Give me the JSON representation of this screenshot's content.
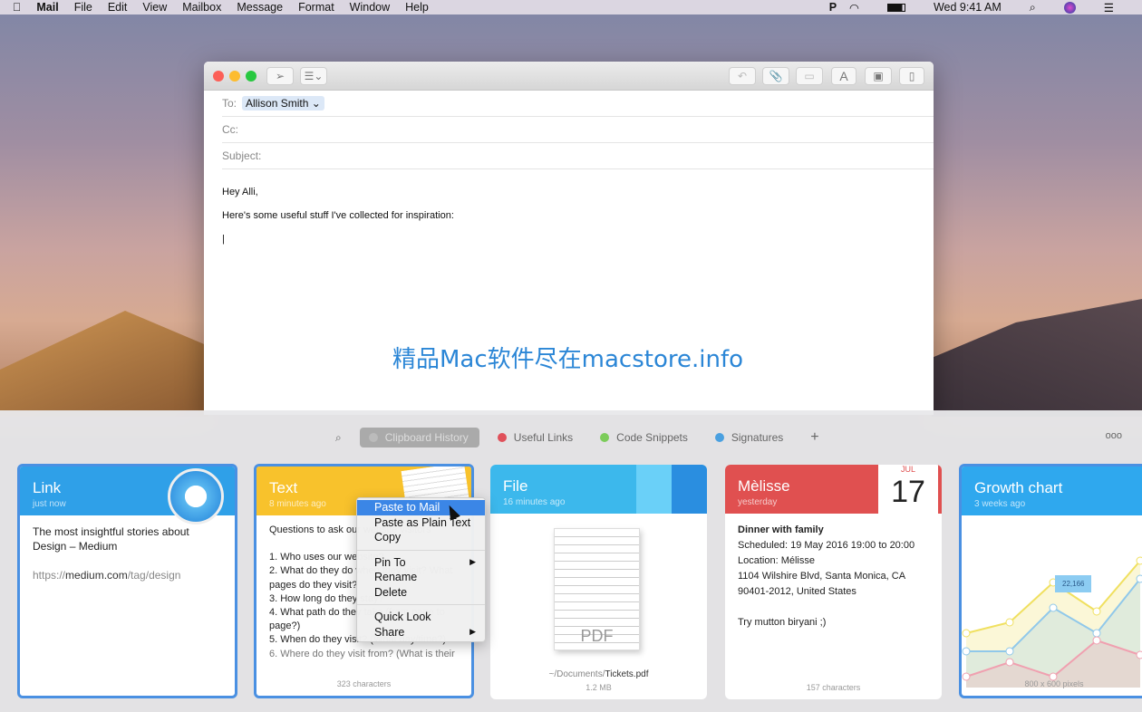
{
  "menubar": {
    "apple": "",
    "items": [
      "Mail",
      "File",
      "Edit",
      "View",
      "Mailbox",
      "Message",
      "Format",
      "Window",
      "Help"
    ],
    "clock": "Wed 9:41 AM"
  },
  "compose": {
    "to_label": "To:",
    "to_value": "Allison Smith",
    "cc_label": "Cc:",
    "subject_label": "Subject:",
    "body": [
      "Hey Alli,",
      "Here's some useful stuff I've collected for inspiration:"
    ]
  },
  "watermark": "精品Mac软件尽在macstore.info",
  "tabs": [
    {
      "label": "Clipboard History",
      "color": "#bbbbbb"
    },
    {
      "label": "Useful Links",
      "color": "#e0505a"
    },
    {
      "label": "Code Snippets",
      "color": "#7ccc5a"
    },
    {
      "label": "Signatures",
      "color": "#4aa0e0"
    }
  ],
  "add": "+",
  "more": "ooo",
  "cards": [
    {
      "type": "Link",
      "time": "just now",
      "color": "#2fa0e8",
      "title": "The most insightful stories about Design – Medium",
      "url_prefix": "https://",
      "url_main": "medium.com",
      "url_path": "/tag/design"
    },
    {
      "type": "Text",
      "time": "8 minutes ago",
      "color": "#f8c22c",
      "lines": [
        "Questions to ask our website visitors",
        "",
        "1. Who uses our website?",
        "2. What do they do when they visit? What pages do they visit?",
        "3. How long do they stay?",
        "4. What path do they take (from page to page?)",
        "5. When do they visit? (What day/time?)",
        "6. Where do they visit from? (What is their"
      ],
      "footer": "323 characters"
    },
    {
      "type": "File",
      "time": "16 minutes ago",
      "color": "#3cb8ec",
      "path": "~/Documents/",
      "file": "Tickets.pdf",
      "icon_text": "PDF",
      "footer": "1.2 MB"
    },
    {
      "type": "Mèlisse",
      "time": "yesterday",
      "color": "#e05050",
      "cal_month": "JUL",
      "cal_day": "17",
      "lines": [
        "Dinner with family",
        "Scheduled: 19 May 2016 19:00 to 20:00",
        "Location: Mélisse",
        "1104 Wilshire Blvd, Santa Monica, CA 90401-2012, United States",
        "",
        "Try mutton biryani ;)"
      ],
      "footer": "157 characters"
    },
    {
      "type": "Growth chart",
      "time": "3 weeks ago",
      "color": "#2fa8ee",
      "tooltip": "22,166",
      "footer": "800 x 600 pixels"
    }
  ],
  "context_menu": [
    "Paste to Mail",
    "Paste as Plain Text",
    "Copy",
    "Pin To",
    "Rename",
    "Delete",
    "Quick Look",
    "Share"
  ],
  "chart_data": {
    "type": "line",
    "series": [
      {
        "color": "#f0e060",
        "values": [
          30,
          36,
          58,
          42,
          70
        ]
      },
      {
        "color": "#90c8ea",
        "values": [
          20,
          20,
          44,
          30,
          60
        ]
      },
      {
        "color": "#f0a0b0",
        "values": [
          6,
          14,
          6,
          26,
          18
        ]
      }
    ],
    "annotations": [
      "22,166"
    ]
  }
}
